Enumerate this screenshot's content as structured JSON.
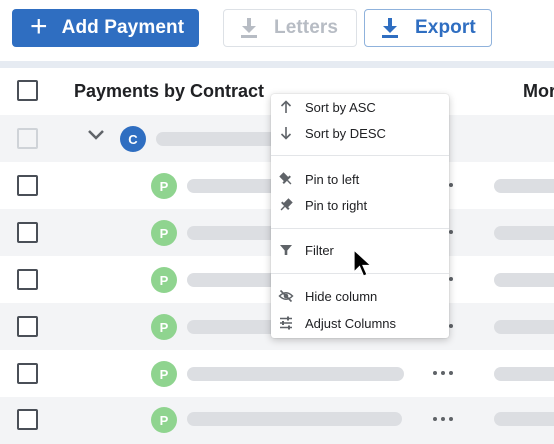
{
  "toolbar": {
    "add_payment": "Add Payment",
    "letters": "Letters",
    "export": "Export",
    "accent_color": "#2f6ec1"
  },
  "table": {
    "header_title": "Payments by Contract",
    "next_column_header_partial": "Mor",
    "group_avatar": "C",
    "row_avatar": "P"
  },
  "column_menu": {
    "sort_asc": "Sort by ASC",
    "sort_desc": "Sort by DESC",
    "pin_left": "Pin to left",
    "pin_right": "Pin to right",
    "filter": "Filter",
    "hide_column": "Hide column",
    "adjust_columns": "Adjust Columns"
  }
}
